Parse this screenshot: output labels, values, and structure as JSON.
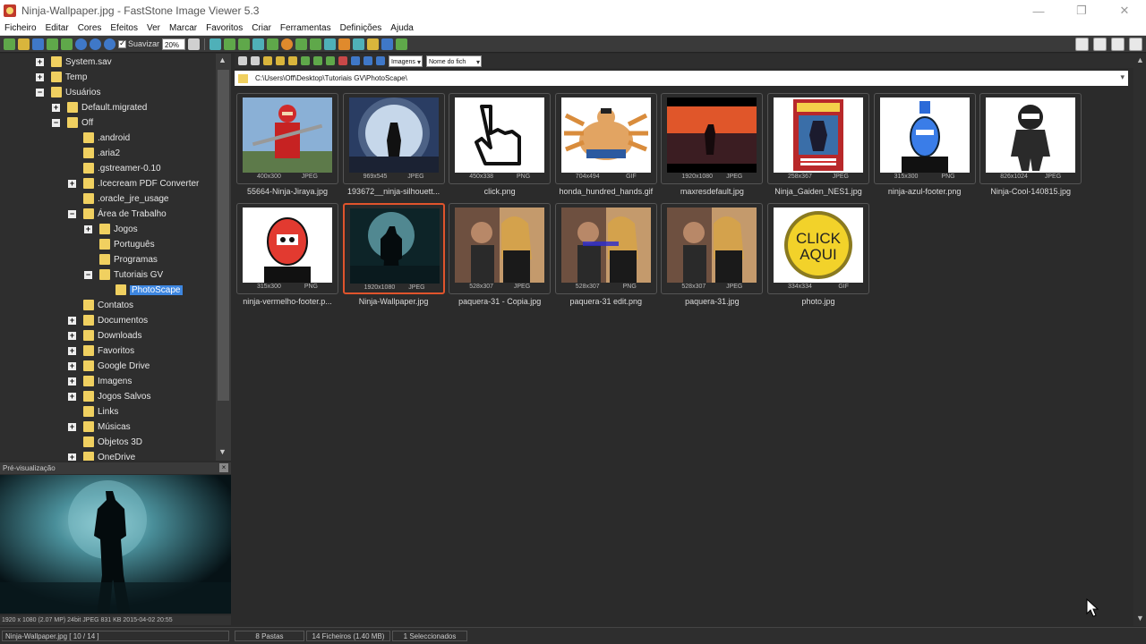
{
  "window": {
    "title": "Ninja-Wallpaper.jpg  -  FastStone Image Viewer 5.3",
    "minimize": "—",
    "maximize": "❐",
    "close": "✕"
  },
  "menu": [
    "Ficheiro",
    "Editar",
    "Cores",
    "Efeitos",
    "Ver",
    "Marcar",
    "Favoritos",
    "Criar",
    "Ferramentas",
    "Definições",
    "Ajuda"
  ],
  "toolbar": {
    "smooth_label": "Suavizar",
    "zoom_value": "20%"
  },
  "tree": [
    {
      "label": "System.sav",
      "expander": "+",
      "level": 3
    },
    {
      "label": "Temp",
      "expander": "+",
      "level": 3
    },
    {
      "label": "Usuários",
      "expander": "−",
      "level": 3
    },
    {
      "label": "Default.migrated",
      "expander": "+",
      "level": 4
    },
    {
      "label": "Off",
      "expander": "−",
      "level": 4
    },
    {
      "label": ".android",
      "expander": "",
      "level": 5
    },
    {
      "label": ".aria2",
      "expander": "",
      "level": 5
    },
    {
      "label": ".gstreamer-0.10",
      "expander": "",
      "level": 5
    },
    {
      "label": ".Icecream PDF Converter",
      "expander": "+",
      "level": 5
    },
    {
      "label": ".oracle_jre_usage",
      "expander": "",
      "level": 5
    },
    {
      "label": "Área de Trabalho",
      "expander": "−",
      "level": 5
    },
    {
      "label": "Jogos",
      "expander": "+",
      "level": 6
    },
    {
      "label": "Português",
      "expander": "",
      "level": 6
    },
    {
      "label": "Programas",
      "expander": "",
      "level": 6
    },
    {
      "label": "Tutoriais GV",
      "expander": "−",
      "level": 6
    },
    {
      "label": "PhotoScape",
      "expander": "",
      "level": 7,
      "selected": true
    },
    {
      "label": "Contatos",
      "expander": "",
      "level": 5
    },
    {
      "label": "Documentos",
      "expander": "+",
      "level": 5
    },
    {
      "label": "Downloads",
      "expander": "+",
      "level": 5
    },
    {
      "label": "Favoritos",
      "expander": "+",
      "level": 5
    },
    {
      "label": "Google Drive",
      "expander": "+",
      "level": 5
    },
    {
      "label": "Imagens",
      "expander": "+",
      "level": 5
    },
    {
      "label": "Jogos Salvos",
      "expander": "+",
      "level": 5
    },
    {
      "label": "Links",
      "expander": "",
      "level": 5
    },
    {
      "label": "Músicas",
      "expander": "+",
      "level": 5
    },
    {
      "label": "Objetos 3D",
      "expander": "",
      "level": 5
    },
    {
      "label": "OneDrive",
      "expander": "+",
      "level": 5
    }
  ],
  "preview": {
    "header": "Pré-visualização",
    "info": "1920 x 1080 (2.07 MP)  24bit  JPEG  831 KB  2015-04-02 20:55"
  },
  "browser": {
    "filter_value": "Imagens",
    "sort_value": "Nome do fich",
    "path": "C:\\Users\\Off\\Desktop\\Tutoriais GV\\PhotoScape\\"
  },
  "thumbnails": [
    {
      "name": "55664-Ninja-Jiraya.jpg",
      "dims": "400x300",
      "type": "JPEG",
      "art": "red-ninja"
    },
    {
      "name": "193672__ninja-silhouett...",
      "dims": "969x545",
      "type": "JPEG",
      "art": "moon-ninja"
    },
    {
      "name": "click.png",
      "dims": "450x338",
      "type": "PNG",
      "art": "hand-cursor"
    },
    {
      "name": "honda_hundred_hands.gif",
      "dims": "704x494",
      "type": "GIF",
      "art": "sumo"
    },
    {
      "name": "maxresdefault.jpg",
      "dims": "1920x1080",
      "type": "JPEG",
      "art": "sunset"
    },
    {
      "name": "Ninja_Gaiden_NES1.jpg",
      "dims": "258x367",
      "type": "JPEG",
      "art": "nes-box"
    },
    {
      "name": "ninja-azul-footer.png",
      "dims": "315x300",
      "type": "PNG",
      "art": "blue-ninja"
    },
    {
      "name": "Ninja-Cool-140815.jpg",
      "dims": "826x1024",
      "type": "JPEG",
      "art": "black-ninja"
    },
    {
      "name": "ninja-vermelho-footer.p...",
      "dims": "315x300",
      "type": "PNG",
      "art": "red-cartoon"
    },
    {
      "name": "Ninja-Wallpaper.jpg",
      "dims": "1920x1080",
      "type": "JPEG",
      "art": "wallpaper",
      "selected": true
    },
    {
      "name": "paquera-31 - Copia.jpg",
      "dims": "528x307",
      "type": "JPEG",
      "art": "couple"
    },
    {
      "name": "paquera-31 edit.png",
      "dims": "528x307",
      "type": "PNG",
      "art": "couple-edit"
    },
    {
      "name": "paquera-31.jpg",
      "dims": "528x307",
      "type": "JPEG",
      "art": "couple"
    },
    {
      "name": "photo.jpg",
      "dims": "334x334",
      "type": "GIF",
      "art": "click-button",
      "art_text_1": "CLICK",
      "art_text_2": "AQUI"
    }
  ],
  "statusbar": {
    "current_file": "Ninja-Wallpaper.jpg [ 10 / 14 ]",
    "folders": "8 Pastas",
    "files": "14 Ficheiros (1.40 MB)",
    "selected": "1 Seleccionados"
  },
  "colors": {
    "selection_border": "#e0542c",
    "tree_selection": "#3d86e0",
    "folder": "#f0d060"
  }
}
